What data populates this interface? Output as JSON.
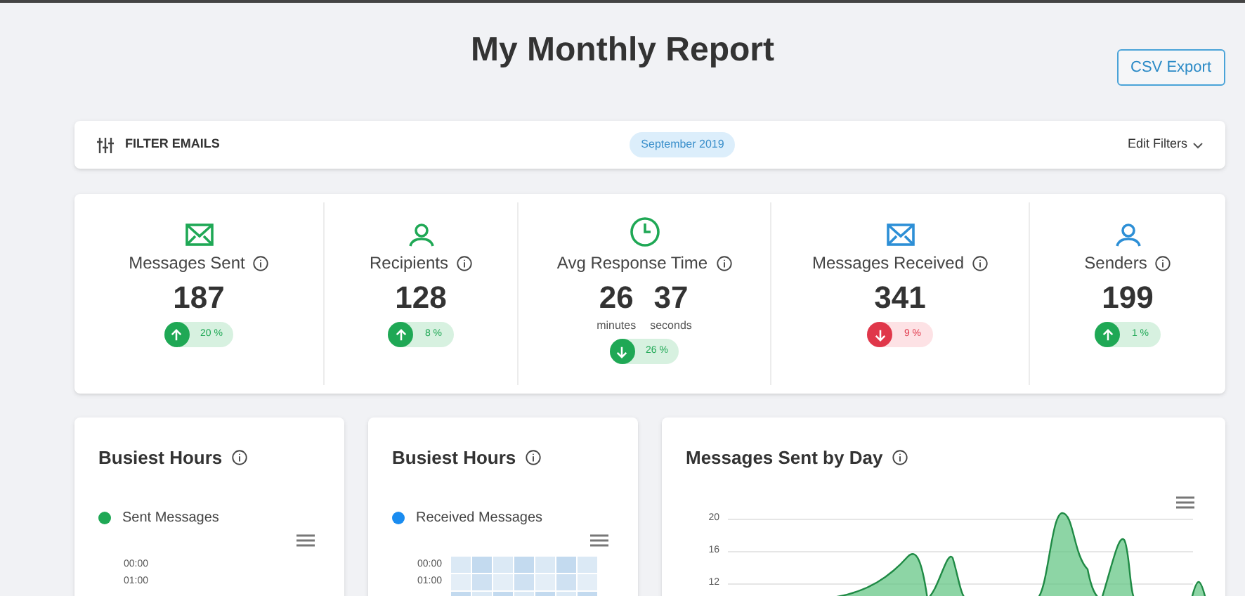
{
  "header": {
    "title": "My Monthly Report",
    "export_button": "CSV Export"
  },
  "filter_bar": {
    "label": "FILTER EMAILS",
    "period": "September 2019",
    "edit": "Edit Filters"
  },
  "stats": [
    {
      "kind": "mail",
      "color": "#1fa855",
      "label": "Messages Sent",
      "values": [
        {
          "number": "187"
        }
      ],
      "rising": true,
      "positive": true,
      "change": "20 %"
    },
    {
      "kind": "person",
      "color": "#1fa855",
      "label": "Recipients",
      "values": [
        {
          "number": "128"
        }
      ],
      "rising": true,
      "positive": true,
      "change": "8 %"
    },
    {
      "kind": "clock",
      "color": "#1fa855",
      "label": "Avg Response Time",
      "values": [
        {
          "number": "26",
          "unit": "minutes"
        },
        {
          "number": "37",
          "unit": "seconds"
        }
      ],
      "rising": false,
      "positive": true,
      "change": "26 %"
    },
    {
      "kind": "mail",
      "color": "#2d8fd6",
      "label": "Messages Received",
      "values": [
        {
          "number": "341"
        }
      ],
      "rising": false,
      "positive": false,
      "change": "9 %"
    },
    {
      "kind": "person",
      "color": "#2d8fd6",
      "label": "Senders",
      "values": [
        {
          "number": "199"
        }
      ],
      "rising": true,
      "positive": true,
      "change": "1 %"
    }
  ],
  "panels": [
    {
      "kind": "heatmap",
      "title": "Busiest Hours",
      "legend": {
        "label": "Sent Messages",
        "color": "#1fa855"
      },
      "filled": false,
      "row_labels": [
        "00:00",
        "01:00"
      ]
    },
    {
      "kind": "heatmap",
      "title": "Busiest Hours",
      "legend": {
        "label": "Received Messages",
        "color": "#1a8cf0"
      },
      "filled": true,
      "row_labels": [
        "00:00",
        "01:00"
      ]
    },
    {
      "kind": "area",
      "title": "Messages Sent by Day",
      "tick_labels": [
        "20",
        "16",
        "12"
      ]
    }
  ]
}
